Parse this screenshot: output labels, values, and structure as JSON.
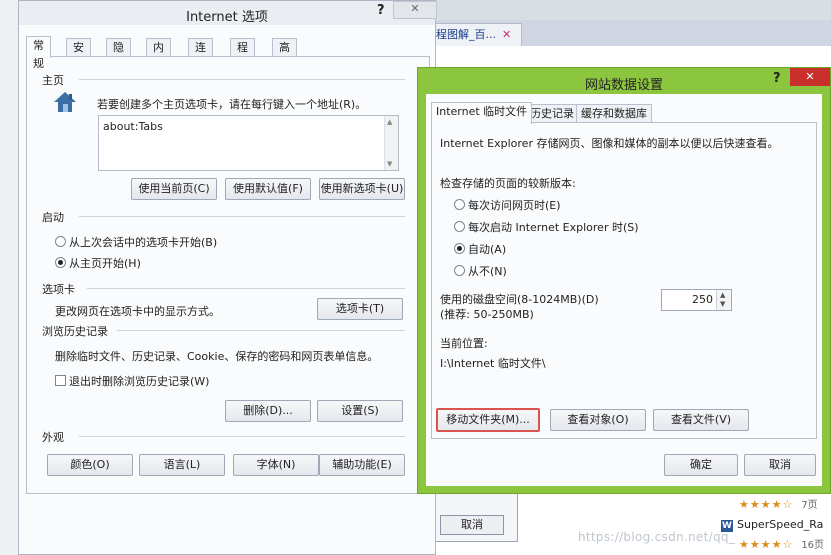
{
  "bg": {
    "tab_title": "程图解_百...",
    "cancel_label": "取消",
    "rating_stars": "★★★★☆",
    "page_count_1": "7页",
    "doc_title": "SuperSpeed_Ra",
    "page_count_2": "16页",
    "watermark": "https://blog.csdn.net/qq_",
    "colors": {
      "dialog_border": "#aeb6c3",
      "sub_frame": "#8cc63e",
      "close_red": "#c9302c"
    }
  },
  "dialog": {
    "title": "Internet 选项",
    "help": "?",
    "close": "✕",
    "tabs": [
      "常规",
      "安全",
      "隐私",
      "内容",
      "连接",
      "程序",
      "高级"
    ],
    "home": {
      "section": "主页",
      "hint": "若要创建多个主页选项卡，请在每行键入一个地址(R)。",
      "value": "about:Tabs",
      "btn_current": "使用当前页(C)",
      "btn_default": "使用默认值(F)",
      "btn_newtab": "使用新选项卡(U)"
    },
    "startup": {
      "section": "启动",
      "opt1": "从上次会话中的选项卡开始(B)",
      "opt2": "从主页开始(H)",
      "selected": 2
    },
    "tabs_sec": {
      "section": "选项卡",
      "desc": "更改网页在选项卡中的显示方式。",
      "btn": "选项卡(T)"
    },
    "history": {
      "section": "浏览历史记录",
      "desc": "删除临时文件、历史记录、Cookie、保存的密码和网页表单信息。",
      "check": "退出时删除浏览历史记录(W)",
      "checked": false,
      "btn_delete": "删除(D)...",
      "btn_settings": "设置(S)"
    },
    "appearance": {
      "section": "外观",
      "btn_colors": "颜色(O)",
      "btn_lang": "语言(L)",
      "btn_font": "字体(N)",
      "btn_access": "辅助功能(E)"
    }
  },
  "sub": {
    "title": "网站数据设置",
    "help": "?",
    "close": "✕",
    "tabs": [
      "Internet 临时文件",
      "历史记录",
      "缓存和数据库"
    ],
    "desc": "Internet Explorer 存储网页、图像和媒体的副本以便以后快速查看。",
    "check_label": "检查存储的页面的较新版本:",
    "options": [
      "每次访问网页时(E)",
      "每次启动 Internet Explorer 时(S)",
      "自动(A)",
      "从不(N)"
    ],
    "selected": 3,
    "disk_label": "使用的磁盘空间(8-1024MB)(D)",
    "disk_recommend": "(推荐: 50-250MB)",
    "disk_value": "250",
    "location_label": "当前位置:",
    "location_value": "I:\\Internet 临时文件\\",
    "btn_move": "移动文件夹(M)...",
    "btn_objects": "查看对象(O)",
    "btn_files": "查看文件(V)",
    "btn_ok": "确定",
    "btn_cancel": "取消"
  }
}
